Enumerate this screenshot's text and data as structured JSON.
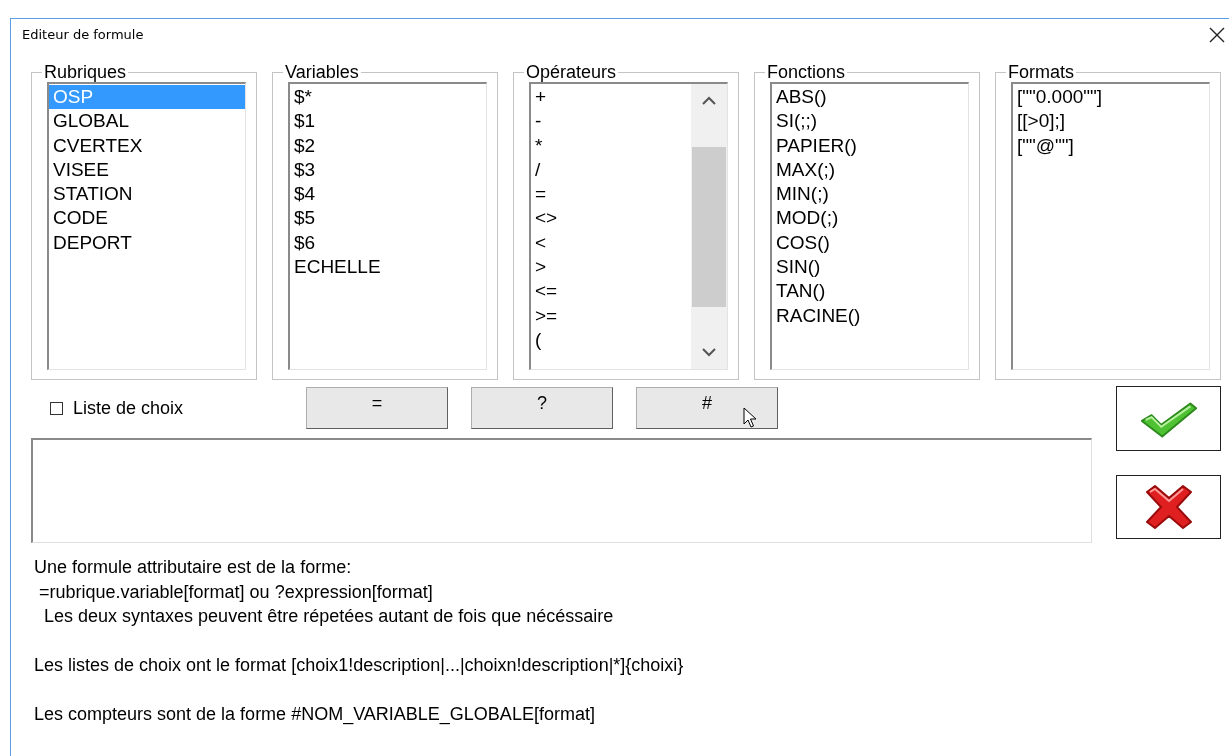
{
  "window": {
    "title": "Editeur de formule"
  },
  "groups": [
    {
      "label": "Rubriques",
      "scrollbar": false,
      "items": [
        {
          "text": "OSP",
          "selected": true
        },
        {
          "text": "GLOBAL",
          "selected": false
        },
        {
          "text": "CVERTEX",
          "selected": false
        },
        {
          "text": "VISEE",
          "selected": false
        },
        {
          "text": "STATION",
          "selected": false
        },
        {
          "text": "CODE",
          "selected": false
        },
        {
          "text": "DEPORT",
          "selected": false
        }
      ]
    },
    {
      "label": "Variables",
      "scrollbar": false,
      "items": [
        {
          "text": "$*",
          "selected": false
        },
        {
          "text": "$1",
          "selected": false
        },
        {
          "text": "$2",
          "selected": false
        },
        {
          "text": "$3",
          "selected": false
        },
        {
          "text": "$4",
          "selected": false
        },
        {
          "text": "$5",
          "selected": false
        },
        {
          "text": "$6",
          "selected": false
        },
        {
          "text": "ECHELLE",
          "selected": false
        }
      ]
    },
    {
      "label": "Opérateurs",
      "scrollbar": true,
      "items": [
        {
          "text": "+",
          "selected": false
        },
        {
          "text": "-",
          "selected": false
        },
        {
          "text": "*",
          "selected": false
        },
        {
          "text": "/",
          "selected": false
        },
        {
          "text": "=",
          "selected": false
        },
        {
          "text": "<>",
          "selected": false
        },
        {
          "text": "<",
          "selected": false
        },
        {
          "text": ">",
          "selected": false
        },
        {
          "text": "<=",
          "selected": false
        },
        {
          "text": ">=",
          "selected": false
        },
        {
          "text": "(",
          "selected": false
        }
      ]
    },
    {
      "label": "Fonctions",
      "scrollbar": false,
      "items": [
        {
          "text": "ABS()",
          "selected": false
        },
        {
          "text": "SI(;;)",
          "selected": false
        },
        {
          "text": "PAPIER()",
          "selected": false
        },
        {
          "text": "MAX(;)",
          "selected": false
        },
        {
          "text": "MIN(;)",
          "selected": false
        },
        {
          "text": "MOD(;)",
          "selected": false
        },
        {
          "text": "COS()",
          "selected": false
        },
        {
          "text": "SIN()",
          "selected": false
        },
        {
          "text": "TAN()",
          "selected": false
        },
        {
          "text": "RACINE()",
          "selected": false
        }
      ]
    },
    {
      "label": "Formats",
      "scrollbar": false,
      "items": [
        {
          "text": "[\"\"0.000\"\"]",
          "selected": false
        },
        {
          "text": "[[>0];]",
          "selected": false
        },
        {
          "text": "[\"\"@\"\"]",
          "selected": false
        }
      ]
    }
  ],
  "choice_list": {
    "label": "Liste de choix",
    "checked": false
  },
  "insert_buttons": [
    "=",
    "?",
    "#"
  ],
  "help": [
    [
      " Une formule attributaire est de la forme:",
      "  =rubrique.variable[format] ou ?expression[format]",
      "   Les deux syntaxes peuvent être répetées autant de fois que nécéssaire"
    ],
    [
      " Les listes de choix ont le format [choix1!description|...|choixn!description|*]{choixi}"
    ],
    [
      " Les compteurs sont de la forme #NOM_VARIABLE_GLOBALE[format]"
    ]
  ]
}
